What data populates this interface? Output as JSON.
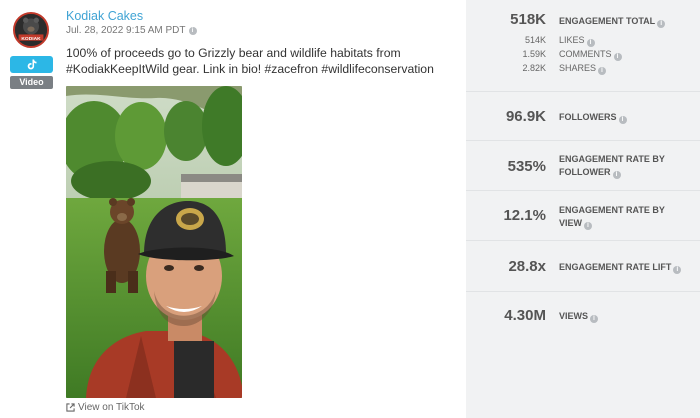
{
  "post": {
    "author": "Kodiak Cakes",
    "date": "Jul. 28, 2022 9:15 AM PDT",
    "caption": "100% of proceeds go to Grizzly bear and wildlife habitats from #KodiakKeepItWild gear. Link in bio! #zacefron #wildlifeconservation",
    "platform_icon": "tiktok-icon",
    "type_label": "Video",
    "avatar_text": "KODIAK",
    "view_link": "View on TikTok"
  },
  "stats": {
    "engagement_total": {
      "value": "518K",
      "label": "ENGAGEMENT TOTAL"
    },
    "likes": {
      "value": "514K",
      "label": "LIKES"
    },
    "comments": {
      "value": "1.59K",
      "label": "COMMENTS"
    },
    "shares": {
      "value": "2.82K",
      "label": "SHARES"
    },
    "followers": {
      "value": "96.9K",
      "label": "FOLLOWERS"
    },
    "engagement_rate_follower": {
      "value": "535%",
      "label": "ENGAGEMENT RATE BY FOLLOWER"
    },
    "engagement_rate_view": {
      "value": "12.1%",
      "label": "ENGAGEMENT RATE BY VIEW"
    },
    "engagement_rate_lift": {
      "value": "28.8x",
      "label": "ENGAGEMENT RATE LIFT"
    },
    "views": {
      "value": "4.30M",
      "label": "VIEWS"
    }
  },
  "colors": {
    "link": "#3fa3d4",
    "tiktok_badge": "#2cb7e6",
    "panel_bg": "#f1f2f3"
  }
}
